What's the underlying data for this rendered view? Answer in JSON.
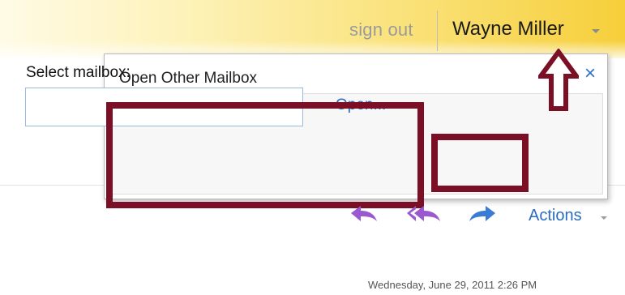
{
  "header": {
    "sign_out": "sign out",
    "user_name": "Wayne Miller"
  },
  "popup": {
    "title": "Open Other Mailbox",
    "close": "×",
    "select_label": "Select mailbox:",
    "input_value": "",
    "open_link": "Open..."
  },
  "toolbar": {
    "actions_label": "Actions",
    "icons": [
      "reply-icon",
      "reply-all-icon",
      "forward-icon"
    ]
  },
  "message": {
    "timestamp": "Wednesday, June 29, 2011 2:26 PM"
  },
  "colors": {
    "highlight": "#7b0f26",
    "link": "#2a6cc0",
    "reply_icon": "#9b59d0",
    "forward_icon": "#3a7bd5"
  }
}
